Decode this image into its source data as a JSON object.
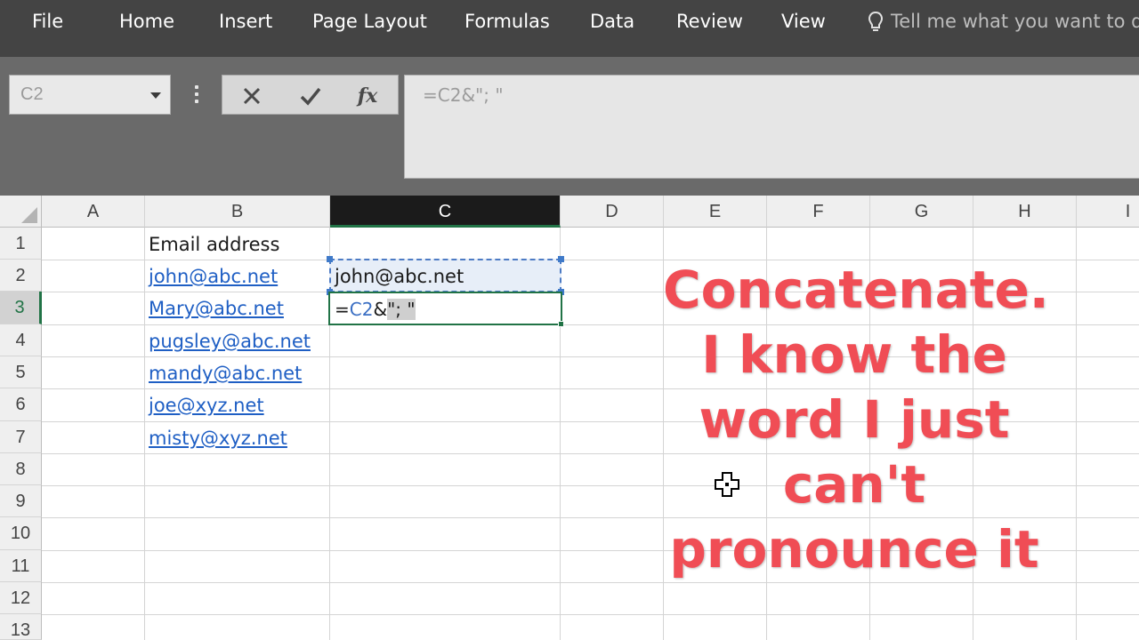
{
  "ribbon": {
    "tabs": [
      {
        "label": "File"
      },
      {
        "label": "Home"
      },
      {
        "label": "Insert"
      },
      {
        "label": "Page Layout"
      },
      {
        "label": "Formulas"
      },
      {
        "label": "Data"
      },
      {
        "label": "Review"
      },
      {
        "label": "View"
      }
    ],
    "tell_me": "Tell me what you want to do"
  },
  "formula_bar": {
    "name_box": "C2",
    "formula": "=C2&\"; \"",
    "fx_label": "fx",
    "cancel_icon": "x-icon",
    "enter_icon": "check-icon"
  },
  "columns": [
    "A",
    "B",
    "C",
    "D",
    "E",
    "F",
    "G",
    "H",
    "I"
  ],
  "rows": [
    "1",
    "2",
    "3",
    "4",
    "5",
    "6",
    "7",
    "8",
    "9",
    "10",
    "11",
    "12",
    "13"
  ],
  "selected_column": "C",
  "selected_row": "3",
  "cells": {
    "B1": "Email address",
    "B2": "john@abc.net",
    "B3": "Mary@abc.net",
    "B4": "pugsley@abc.net",
    "B5": "mandy@abc.net",
    "B6": "joe@xyz.net",
    "B7": "misty@xyz.net",
    "C2": "john@abc.net",
    "C3_formula_prefix": "=",
    "C3_formula_ref": "C2",
    "C3_formula_op": "&",
    "C3_formula_str": "\"; \""
  },
  "overlay": {
    "lines": [
      "Concatenate.",
      "I know the",
      "word I just",
      "can't",
      "pronounce it"
    ],
    "color": "#f04d55"
  },
  "colors": {
    "ribbon": "#444444",
    "formula_area": "#6a6a6a",
    "accent_green": "#217346",
    "link_blue": "#1f5fc4"
  }
}
